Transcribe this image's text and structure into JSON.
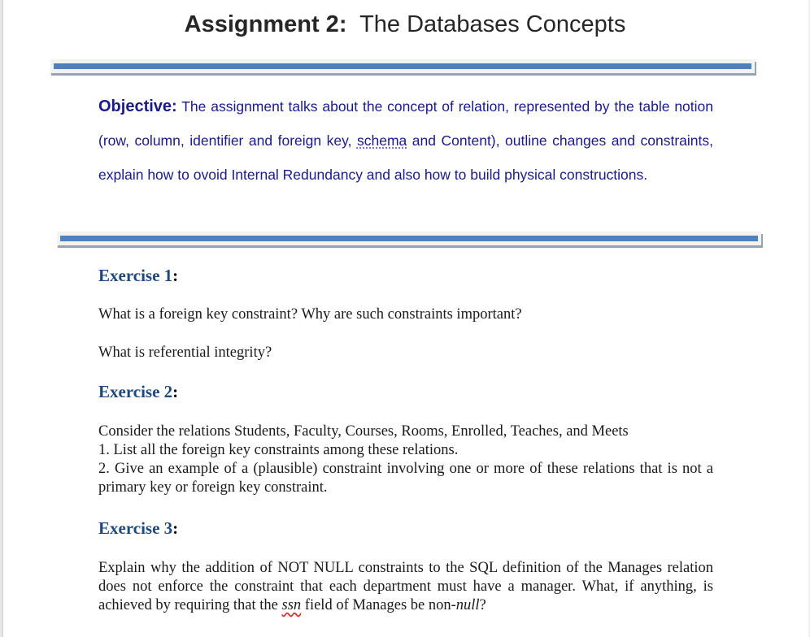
{
  "document": {
    "title_bold": "Assignment 2:",
    "title_rest": "The Databases Concepts",
    "objective": {
      "label": "Objective:",
      "text_before_schema": " The assignment talks about the concept of relation, represented by the table notion (row, column, identifier and foreign key, ",
      "schema_word": "schema",
      "text_after_schema": " and Content), outline changes and constraints, explain how to ovoid Internal Redundancy and also how to build physical constructions."
    },
    "exercises": [
      {
        "heading": "Exercise 1",
        "colon": ":",
        "lines": [
          "What is a foreign key constraint? Why are such constraints important?",
          "What is referential integrity?"
        ]
      },
      {
        "heading": "Exercise 2",
        "colon": ":",
        "lines": [
          "Consider the relations Students, Faculty, Courses, Rooms, Enrolled, Teaches, and Meets",
          "1. List all the foreign key constraints among these relations.",
          "2. Give an example of a (plausible) constraint involving one or more of these relations that is not a primary key or foreign key constraint."
        ]
      },
      {
        "heading": "Exercise 3",
        "colon": ":",
        "text_part1": "Explain why the addition of NOT NULL constraints to the SQL definition of the Manages relation does not enforce the constraint that each department must have a manager. What, if anything, is achieved by requiring that the ",
        "ssn_word": "ssn",
        "text_part2": " field of Manages be non-",
        "null_word": "null",
        "text_part3": "?"
      }
    ],
    "colors": {
      "rule_blue": "#4f81bd",
      "objective_text": "#1a1a8c",
      "heading_blue": "#1f497d"
    }
  }
}
